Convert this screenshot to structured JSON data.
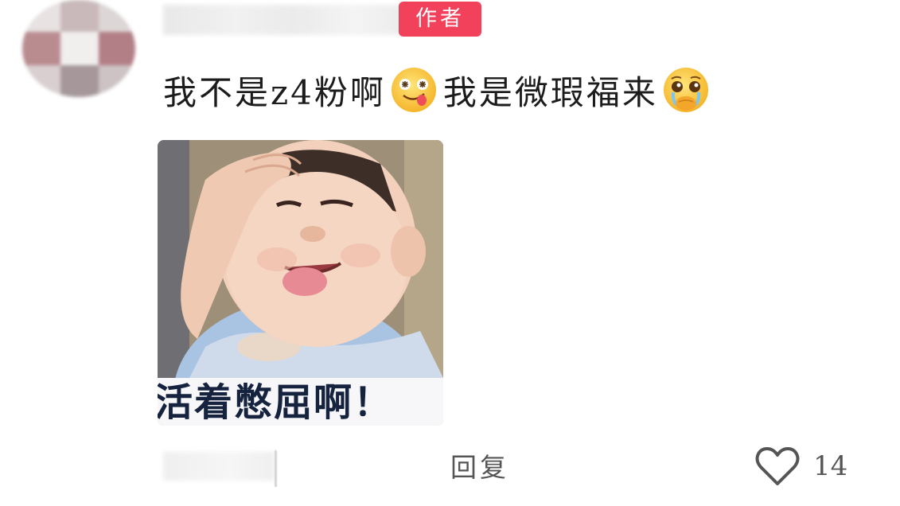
{
  "comment": {
    "author_badge": "作者",
    "text_part1": "我不是z4粉啊",
    "text_part2": "我是微瑕福来",
    "emoji1": "tongue-out-face-icon",
    "emoji2": "teary-pleading-face-icon",
    "image": {
      "caption": "活着憋屈啊！"
    },
    "footer": {
      "reply_label": "回复",
      "like_count": "14"
    }
  },
  "colors": {
    "badge": "#f2415a",
    "text": "#1c1c1c",
    "muted": "#555555"
  }
}
